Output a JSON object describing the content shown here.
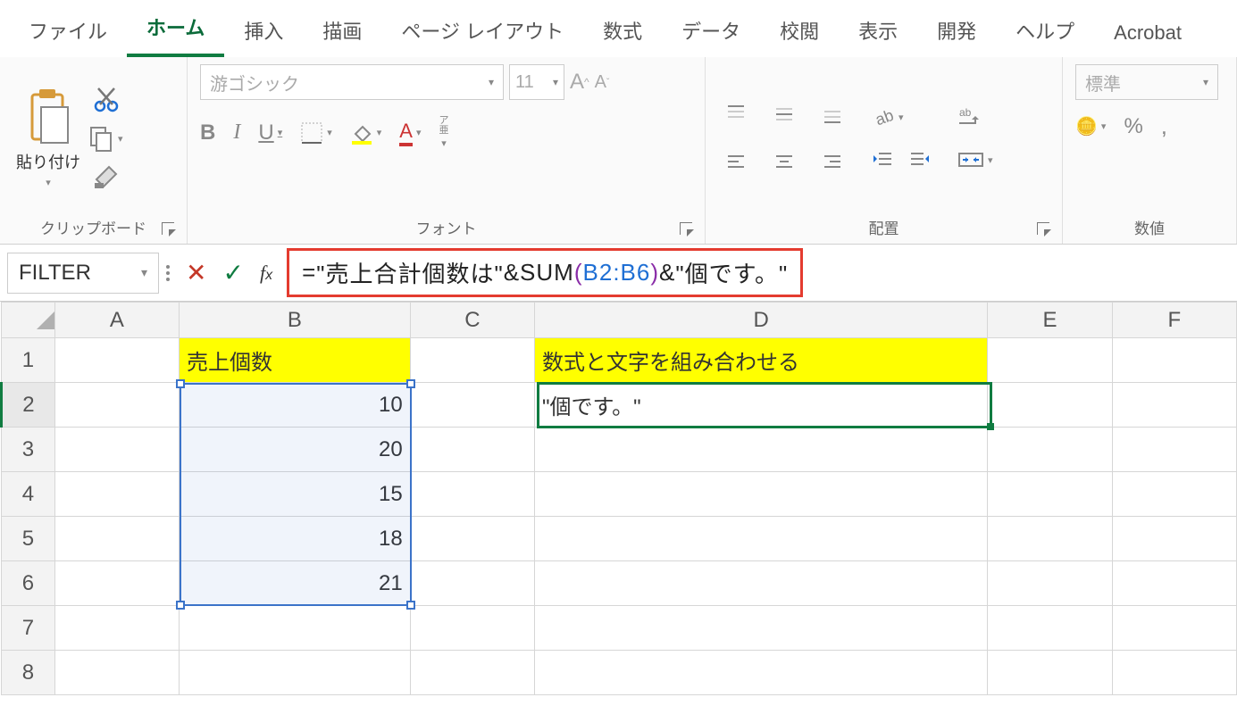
{
  "menu": {
    "tabs": [
      "ファイル",
      "ホーム",
      "挿入",
      "描画",
      "ページ レイアウト",
      "数式",
      "データ",
      "校閲",
      "表示",
      "開発",
      "ヘルプ",
      "Acrobat"
    ],
    "active_index": 1
  },
  "ribbon": {
    "clipboard": {
      "paste_label": "貼り付け",
      "group_label": "クリップボード"
    },
    "font": {
      "font_name": "游ゴシック",
      "font_size": "11",
      "group_label": "フォント",
      "ruby_label": "ア\n亜"
    },
    "alignment": {
      "group_label": "配置",
      "wrap_label": "ab"
    },
    "number": {
      "group_label": "数値",
      "format_name": "標準"
    }
  },
  "formula_bar": {
    "name_box": "FILTER",
    "formula_parts": {
      "p0": "=",
      "p1": "\"売上合計個数は\"",
      "p2": "&SUM",
      "p3": "(",
      "p4": "B2:B6",
      "p5": ")",
      "p6": "&",
      "p7": "\"個です。\""
    }
  },
  "sheet": {
    "columns": [
      "A",
      "B",
      "C",
      "D",
      "E",
      "F"
    ],
    "rows": [
      "1",
      "2",
      "3",
      "4",
      "5",
      "6",
      "7",
      "8"
    ],
    "cells": {
      "B1": "売上個数",
      "D1": "数式と文字を組み合わせる",
      "B2": "10",
      "B3": "20",
      "B4": "15",
      "B5": "18",
      "B6": "21",
      "D2": "\"個です。\""
    },
    "selected_range": "B2:B6",
    "active_cell": "D2"
  }
}
